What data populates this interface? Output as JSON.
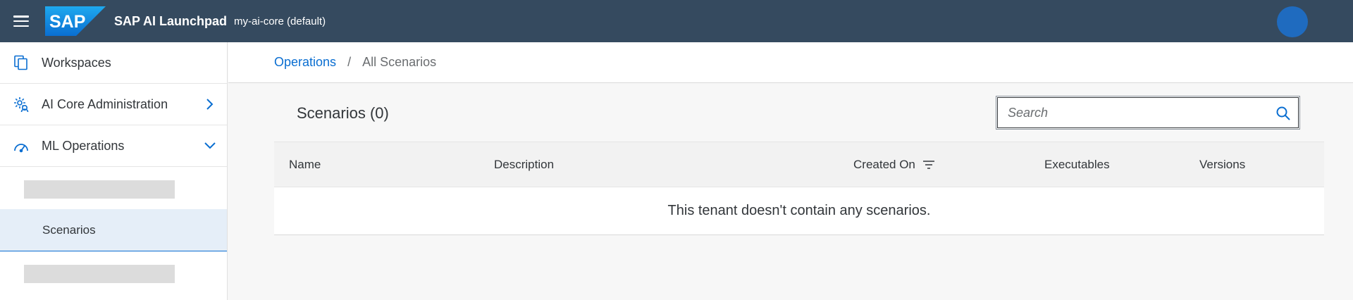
{
  "shell": {
    "app_title": "SAP AI Launchpad",
    "subtitle": "my-ai-core (default)",
    "logo_text": "SAP"
  },
  "sidenav": {
    "items": [
      {
        "label": "Workspaces",
        "icon": "workspaces-icon"
      },
      {
        "label": "AI Core Administration",
        "icon": "admin-settings-icon",
        "chevron": "chevron-right-icon"
      },
      {
        "label": "ML Operations",
        "icon": "gauge-icon",
        "chevron": "chevron-down-icon",
        "expanded": true
      }
    ],
    "sub_items": [
      {
        "label": "",
        "placeholder": true
      },
      {
        "label": "Scenarios",
        "selected": true
      },
      {
        "label": "",
        "placeholder": true
      }
    ]
  },
  "breadcrumb": {
    "link": "Operations",
    "separator": "/",
    "current": "All Scenarios"
  },
  "main": {
    "table_title": "Scenarios (0)",
    "search_placeholder": "Search",
    "columns": [
      "Name",
      "Description",
      "Created On",
      "Executables",
      "Versions"
    ],
    "empty_message": "This tenant doesn't contain any scenarios."
  },
  "colors": {
    "shell_bg": "#354a5f",
    "accent": "#0a6ed1",
    "avatar": "#1f6bbf",
    "selected_bg": "#e5eef8"
  }
}
